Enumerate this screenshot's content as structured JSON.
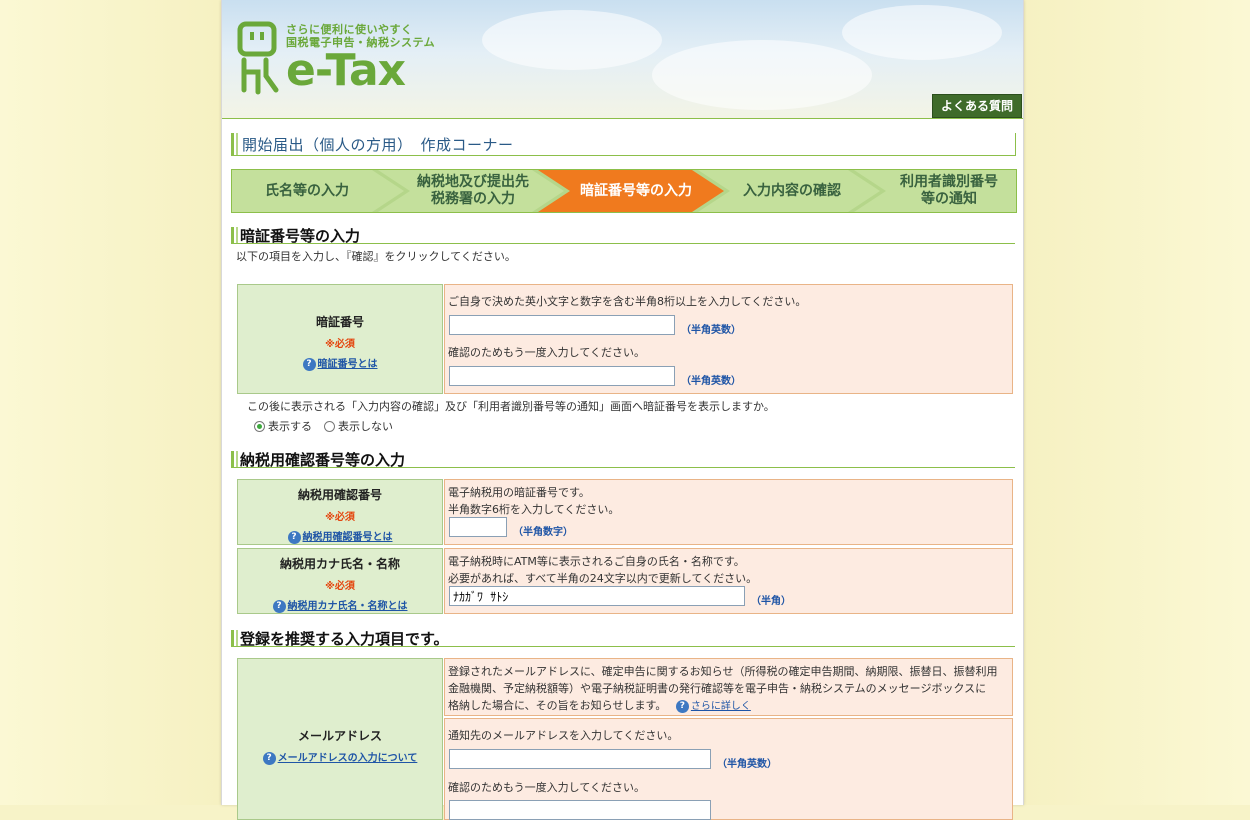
{
  "header": {
    "tagline_1": "さらに便利に使いやすく",
    "tagline_2": "国税電子申告・納税システム",
    "logo_text": "e-Tax",
    "faq_label": "よくある質問"
  },
  "page_title": "開始届出（個人の方用）　作成コーナー",
  "steps": [
    {
      "label": "氏名等の入力",
      "active": false
    },
    {
      "label": "納税地及び提出先\n税務署の入力",
      "active": false
    },
    {
      "label": "暗証番号等の入力",
      "active": true
    },
    {
      "label": "入力内容の確認",
      "active": false
    },
    {
      "label": "利用者識別番号\n等の通知",
      "active": false
    }
  ],
  "section1": {
    "title": "暗証番号等の入力",
    "intro": "以下の項目を入力し、『確認』をクリックしてください。",
    "pin": {
      "label": "暗証番号",
      "required": "※必須",
      "help": "暗証番号とは",
      "instruction": "ご自身で決めた英小文字と数字を含む半角8桁以上を入力してください。",
      "hint": "（半角英数）",
      "confirm_instruction": "確認のためもう一度入力してください。",
      "confirm_hint": "（半角英数）",
      "value": "",
      "confirm_value": ""
    },
    "display_question": "この後に表示される「入力内容の確認」及び「利用者識別番号等の通知」画面へ暗証番号を表示しますか。",
    "radio_show": "表示する",
    "radio_hide": "表示しない",
    "radio_selected": "show"
  },
  "section2": {
    "title": "納税用確認番号等の入力",
    "confirm_no": {
      "label": "納税用確認番号",
      "required": "※必須",
      "help": "納税用確認番号とは",
      "line1": "電子納税用の暗証番号です。",
      "line2": "半角数字6桁を入力してください。",
      "hint": "（半角数字）",
      "value": ""
    },
    "kana": {
      "label": "納税用カナ氏名・名称",
      "required": "※必須",
      "help": "納税用カナ氏名・名称とは",
      "line1": "電子納税時にATM等に表示されるご自身の氏名・名称です。",
      "line2": "必要があれば、すべて半角の24文字以内で更新してください。",
      "hint": "（半角）",
      "value": "ﾅｶｶﾞﾜ ｻﾄｼ"
    }
  },
  "section3": {
    "title": "登録を推奨する入力項目です。",
    "email": {
      "label": "メールアドレス",
      "help": "メールアドレスの入力について",
      "desc_line1": "登録されたメールアドレスに、確定申告に関するお知らせ（所得税の確定申告期間、納期限、振替日、振替利用",
      "desc_line2": "金融機関、予定納税額等）や電子納税証明書の発行確認等を電子申告・納税システムのメッセージボックスに",
      "desc_line3": "格納した場合に、その旨をお知らせします。",
      "more_link": "さらに詳しく",
      "instruction": "通知先のメールアドレスを入力してください。",
      "hint": "（半角英数）",
      "confirm_instruction": "確認のためもう一度入力してください。",
      "value": "",
      "confirm_value": ""
    }
  },
  "colors": {
    "accent_green": "#8cbf4a",
    "active_step": "#f07a1e",
    "label_bg": "#dfeece",
    "input_bg": "#fdebe1",
    "required_red": "#e4460f",
    "link_blue": "#1f55a6"
  }
}
